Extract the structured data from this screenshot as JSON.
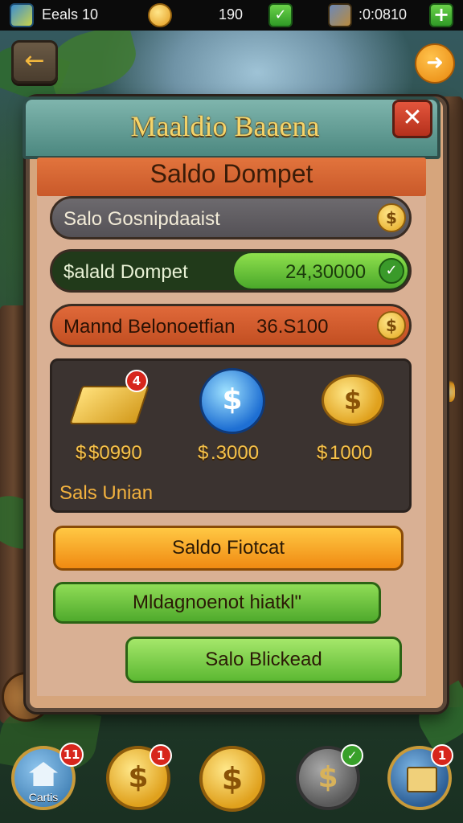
{
  "topbar": {
    "resource_1": "Eeals 10",
    "resource_2": "190",
    "resource_3": ":0:0810",
    "add_symbol": "+",
    "check_symbol": "✓"
  },
  "header": {
    "back_symbol": "←",
    "info_symbol": "➜"
  },
  "dialog": {
    "title": "Maaldio Baaena",
    "close_symbol": "✕",
    "subtitle": "Saldo Dompet",
    "rows": [
      {
        "label": "Salo Gosnipdaaist",
        "value": ""
      },
      {
        "label": "$alald Dompet",
        "value": "24,30000"
      },
      {
        "label": "Mannd Belonoetfian",
        "value": "36.S100"
      }
    ],
    "coin_symbol": "$",
    "items": [
      {
        "price": "$0990",
        "badge": "4"
      },
      {
        "price": ".3000",
        "badge": ""
      },
      {
        "price": "1000",
        "badge": ""
      }
    ],
    "items_label": "Sals Unian",
    "buttons": {
      "primary": "Saldo Fiotcat",
      "secondary": "Mldagnoenot hiatkl\"",
      "tertiary": "Salo Blickead"
    }
  },
  "bottom_nav": [
    {
      "label": "Cartis",
      "badge": "11"
    },
    {
      "label": "",
      "badge": "1"
    },
    {
      "label": "",
      "badge": ""
    },
    {
      "label": "",
      "badge": "✓"
    },
    {
      "label": "",
      "badge": "1"
    }
  ],
  "colors": {
    "panel": "#d6a57c",
    "title_gold": "#f6d469",
    "orange_button": "#f5a623",
    "green_button": "#7ccf3a",
    "close_red": "#d13f27"
  }
}
